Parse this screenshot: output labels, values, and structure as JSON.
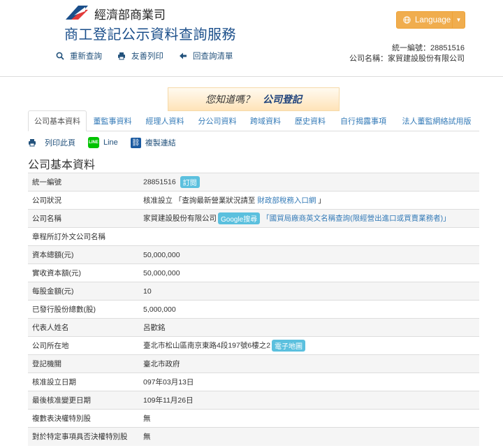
{
  "header": {
    "ministry": "經濟部商業司",
    "site_title": "商工登記公示資料查詢服務",
    "nav": [
      {
        "label": "重新查詢",
        "icon": "search-icon"
      },
      {
        "label": "友善列印",
        "icon": "print-icon"
      },
      {
        "label": "回查詢清單",
        "icon": "arrow-left-icon"
      }
    ],
    "language_label": "Language",
    "meta": {
      "id_line": "統一編號：28851516",
      "name_line": "公司名稱：家貿建設股份有限公司"
    }
  },
  "banner": {
    "prefix": "您知道嗎？",
    "highlight": "公司登記"
  },
  "tabs": [
    {
      "label": "公司基本資料",
      "active": true
    },
    {
      "label": "董監事資料"
    },
    {
      "label": "經理人資料"
    },
    {
      "label": "分公司資料"
    },
    {
      "label": "跨域資料"
    },
    {
      "label": "歷史資料"
    },
    {
      "label": "自行揭露事項"
    },
    {
      "label": "法人董監網絡試用版"
    }
  ],
  "tools": {
    "print": "列印此頁",
    "line": "Line",
    "line_icon_text": "LINE",
    "copy": "複製連結"
  },
  "section_title": "公司基本資料",
  "rows": [
    {
      "label": "統一編號",
      "value": "28851516",
      "badge": "訂閱"
    },
    {
      "label": "公司狀況",
      "value": "核准設立 「查詢最新營業狀況請至",
      "link": "財政部稅務入口網",
      "suffix": " 」"
    },
    {
      "label": "公司名稱",
      "value": "家貿建設股份有限公司",
      "badge": "Google搜尋",
      "link": "「國貿局廠商英文名稱查詢(限經營出進口或買賣業務者)」"
    },
    {
      "label": "章程所訂外文公司名稱",
      "value": ""
    },
    {
      "label": "資本總額(元)",
      "value": "50,000,000"
    },
    {
      "label": "實收資本額(元)",
      "value": "50,000,000"
    },
    {
      "label": "每股金額(元)",
      "value": "10"
    },
    {
      "label": "已發行股份總數(股)",
      "value": "5,000,000"
    },
    {
      "label": "代表人姓名",
      "value": "呂歡銘"
    },
    {
      "label": "公司所在地",
      "value": "臺北市松山區南京東路4段197號6樓之2",
      "badge": "電子地圖"
    },
    {
      "label": "登記機關",
      "value": "臺北市政府"
    },
    {
      "label": "核准設立日期",
      "value": "097年03月13日"
    },
    {
      "label": "最後核准變更日期",
      "value": "109年11月26日"
    },
    {
      "label": "複數表決權特別股",
      "value": "無"
    },
    {
      "label": "對於特定事項具否決權特別股",
      "value": "無"
    }
  ],
  "colors": {
    "brand_blue": "#1a4e8a",
    "accent_orange": "#f0ad4e",
    "badge": "#5bc0de",
    "link": "#337ab7"
  }
}
